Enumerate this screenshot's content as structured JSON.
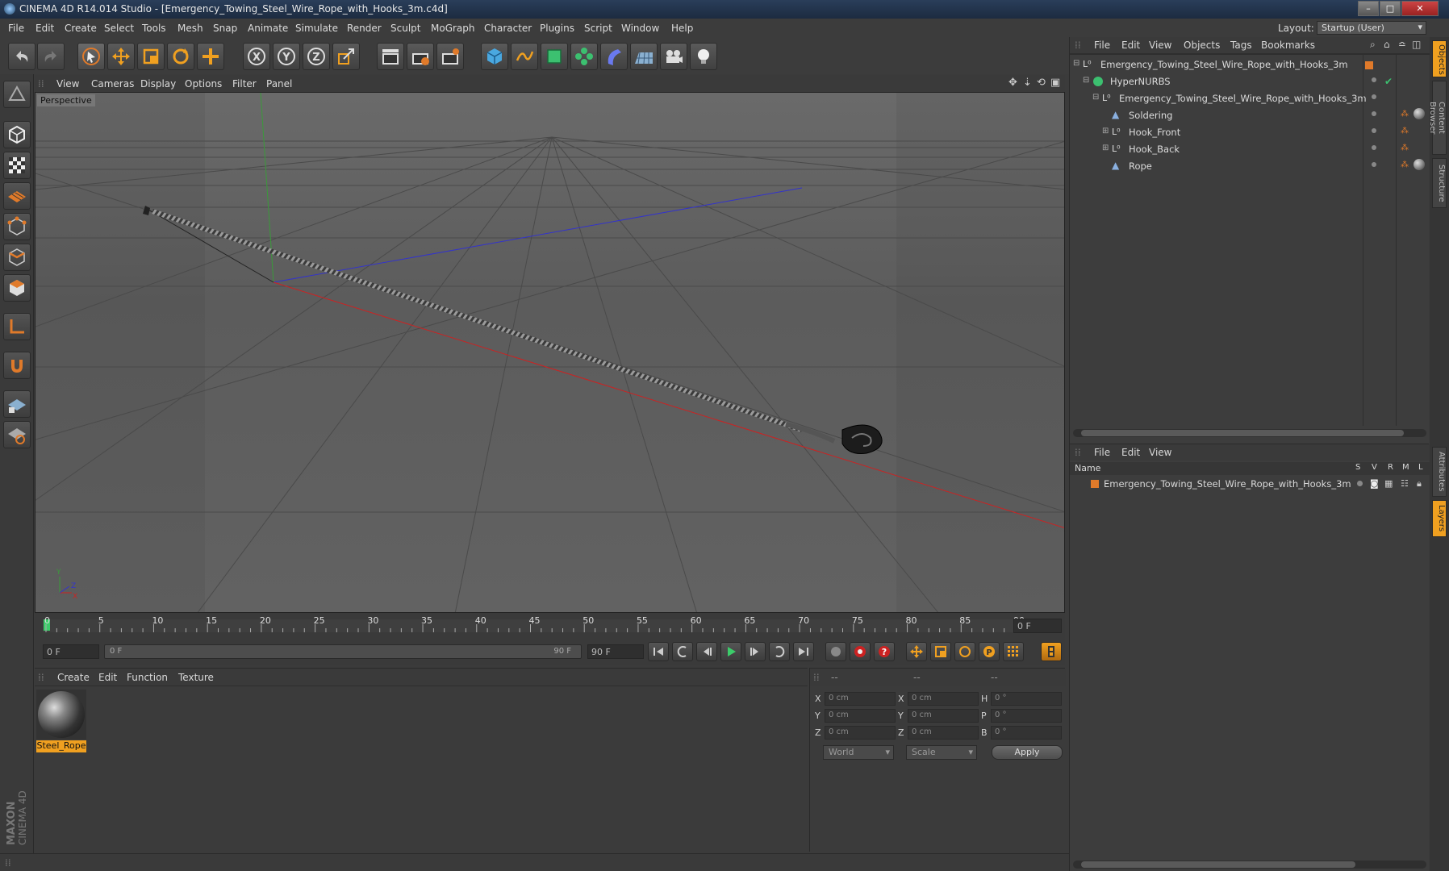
{
  "window": {
    "title": "CINEMA 4D R14.014 Studio - [Emergency_Towing_Steel_Wire_Rope_with_Hooks_3m.c4d]"
  },
  "menubar": {
    "items": [
      "File",
      "Edit",
      "Create",
      "Select",
      "Tools",
      "Mesh",
      "Snap",
      "Animate",
      "Simulate",
      "Render",
      "Sculpt",
      "MoGraph",
      "Character",
      "Plugins",
      "Script",
      "Window",
      "Help"
    ],
    "layout_label": "Layout:",
    "layout_value": "Startup (User)"
  },
  "viewport": {
    "menu": [
      "View",
      "Cameras",
      "Display",
      "Options",
      "Filter",
      "Panel"
    ],
    "label": "Perspective",
    "axis_y": "Y",
    "axis_z": "Z",
    "axis_x": "X"
  },
  "timeline": {
    "ticks": [
      "0",
      "5",
      "10",
      "15",
      "20",
      "25",
      "30",
      "35",
      "40",
      "45",
      "50",
      "55",
      "60",
      "65",
      "70",
      "75",
      "80",
      "85",
      "90"
    ],
    "current_frame": "0 F",
    "start_field": "0 F",
    "range_start": "0 F",
    "range_end": "90 F",
    "end_field": "90 F"
  },
  "material_manager": {
    "menu": [
      "Create",
      "Edit",
      "Function",
      "Texture"
    ],
    "material_name": "Steel_Rope"
  },
  "coordinates": {
    "header": [
      "--",
      "--",
      "--"
    ],
    "rows": [
      {
        "a": "X",
        "av": "0 cm",
        "b": "X",
        "bv": "0 cm",
        "c": "H",
        "cv": "0 °"
      },
      {
        "a": "Y",
        "av": "0 cm",
        "b": "Y",
        "bv": "0 cm",
        "c": "P",
        "cv": "0 °"
      },
      {
        "a": "Z",
        "av": "0 cm",
        "b": "Z",
        "bv": "0 cm",
        "c": "B",
        "cv": "0 °"
      }
    ],
    "world": "World",
    "scale": "Scale",
    "apply": "Apply"
  },
  "object_manager": {
    "menu": [
      "File",
      "Edit",
      "View",
      "Objects",
      "Tags",
      "Bookmarks"
    ],
    "tree": [
      {
        "name": "Emergency_Towing_Steel_Wire_Rope_with_Hooks_3m",
        "depth": 0
      },
      {
        "name": "HyperNURBS",
        "depth": 1
      },
      {
        "name": "Emergency_Towing_Steel_Wire_Rope_with_Hooks_3m",
        "depth": 2
      },
      {
        "name": "Soldering",
        "depth": 3
      },
      {
        "name": "Hook_Front",
        "depth": 3
      },
      {
        "name": "Hook_Back",
        "depth": 3
      },
      {
        "name": "Rope",
        "depth": 3
      }
    ]
  },
  "layer_manager": {
    "menu": [
      "File",
      "Edit",
      "View"
    ],
    "col_name": "Name",
    "cols": [
      "S",
      "V",
      "R",
      "M",
      "L"
    ],
    "layer_name": "Emergency_Towing_Steel_Wire_Rope_with_Hooks_3m"
  },
  "side_tabs": [
    "Objects",
    "Content Browser",
    "Structure",
    "Attributes",
    "Layers"
  ],
  "brand": "MAXON CINEMA 4D",
  "colors": {
    "accent": "#e07a2a",
    "selected": "#f0a020"
  }
}
